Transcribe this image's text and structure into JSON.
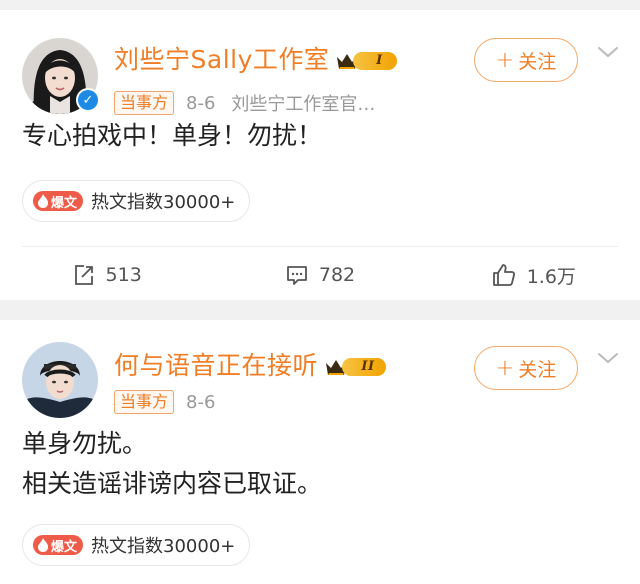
{
  "posts": [
    {
      "author": "刘些宁Sally工作室",
      "vip_level": "I",
      "tag": "当事方",
      "date": "8-6",
      "source": "刘些宁工作室官…",
      "follow_label": "关注",
      "content_lines": [
        "专心拍戏中！单身！勿扰！"
      ],
      "hot_label": "爆文",
      "hot_text": "热文指数30000+",
      "repost_count": "513",
      "comment_count": "782",
      "like_count": "1.6万"
    },
    {
      "author": "何与语音正在接听",
      "vip_level": "II",
      "tag": "当事方",
      "date": "8-6",
      "follow_label": "关注",
      "content_lines": [
        "单身勿扰。",
        "相关造谣诽谤内容已取证。"
      ],
      "hot_label": "爆文",
      "hot_text": "热文指数30000+"
    }
  ],
  "colors": {
    "accent": "#f07e27",
    "background": "#f1f1f1",
    "verified": "#1d8ae6",
    "hot": "#ee5b49",
    "vip_gold": "#f2a300"
  },
  "icons": {
    "repost": "repost-icon",
    "comment": "comment-icon",
    "like": "like-icon",
    "more": "chevron-down-icon",
    "verified": "verified-icon",
    "vip": "crown-icon"
  }
}
